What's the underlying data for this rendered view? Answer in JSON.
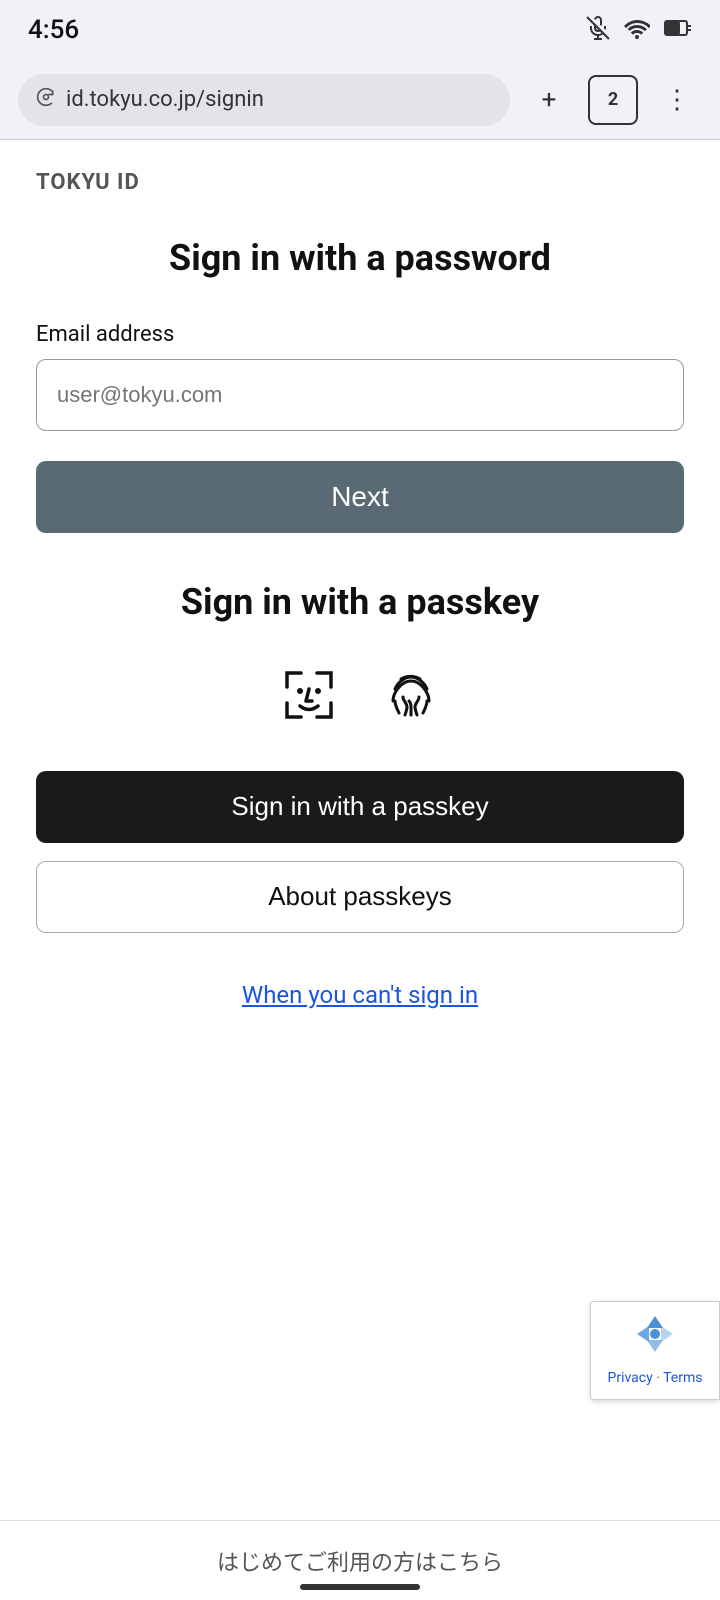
{
  "status_bar": {
    "time": "4:56",
    "icons": [
      "mute",
      "wifi",
      "battery"
    ]
  },
  "browser": {
    "url": "id.tokyu.co.jp/signin",
    "tab_count": "2",
    "add_label": "+",
    "menu_label": "⋮"
  },
  "page": {
    "brand": "TOKYU ID",
    "password_section": {
      "title": "Sign in with a password",
      "email_label": "Email address",
      "email_placeholder": "user@tokyu.com",
      "next_button": "Next"
    },
    "passkey_section": {
      "title": "Sign in with a passkey",
      "face_icon": "face-id",
      "fingerprint_icon": "fingerprint",
      "passkey_button": "Sign in with a passkey",
      "about_button": "About passkeys"
    },
    "cant_signin": "When you can't sign in",
    "recaptcha": {
      "privacy": "Privacy",
      "separator": "·",
      "terms": "Terms"
    },
    "bottom_link": "はじめてご利用の方はこちら"
  }
}
